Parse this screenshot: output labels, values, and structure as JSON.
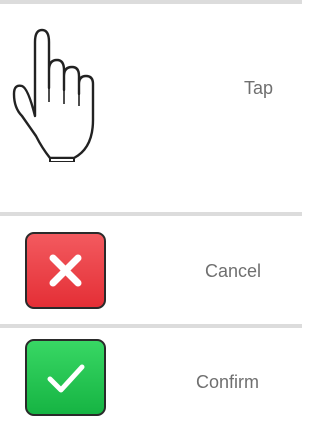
{
  "gestures": {
    "tap": {
      "label": "Tap",
      "icon": "tap-hand-icon"
    }
  },
  "actions": {
    "cancel": {
      "label": "Cancel",
      "icon": "close-icon",
      "color": "#e8383f"
    },
    "confirm": {
      "label": "Confirm",
      "icon": "check-icon",
      "color": "#1fc04e"
    }
  }
}
